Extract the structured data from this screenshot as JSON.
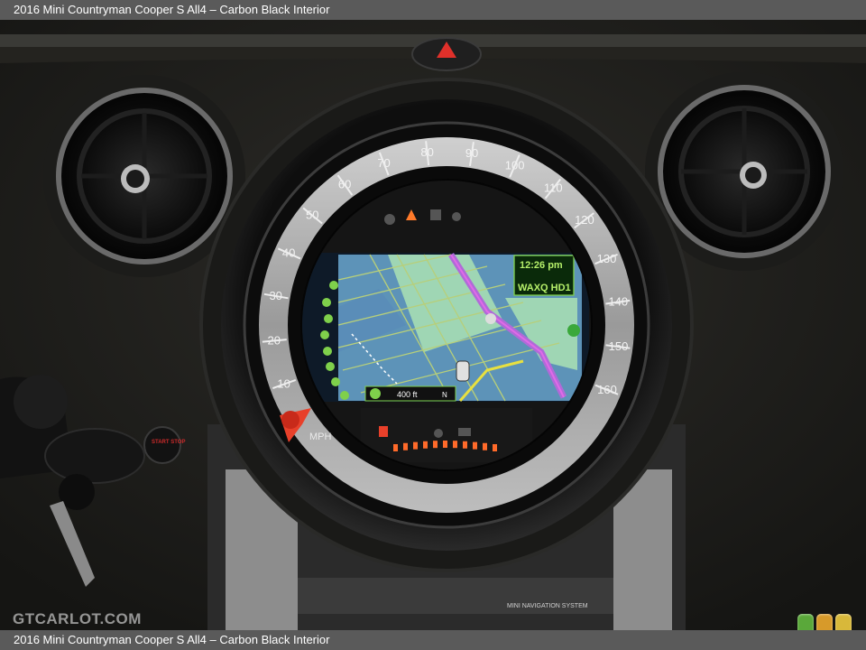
{
  "caption": {
    "top_title": "2016 Mini Countryman Cooper S All4 – Carbon Black Interior",
    "bottom_title": "2016 Mini Countryman Cooper S All4 – Carbon Black Interior"
  },
  "watermark": "GTCARLOT.COM",
  "speedometer": {
    "ticks": [
      "10",
      "20",
      "30",
      "40",
      "50",
      "60",
      "70",
      "80",
      "90",
      "100",
      "110",
      "120",
      "130",
      "140",
      "150",
      "160"
    ],
    "unit": "MPH"
  },
  "navigation": {
    "time": "12:26 pm",
    "station": "WAXQ HD1",
    "distance": "400 ft",
    "heading": "N",
    "system_label": "MINI NAVIGATION SYSTEM"
  },
  "start_stop_label": "START STOP",
  "rating_colors": [
    "#5aa83a",
    "#d79a2a",
    "#d8b83a"
  ],
  "colors": {
    "screen_green": "#7fd04b",
    "map_road": "#b06ad8",
    "warning_red": "#e8402a",
    "gauge_orange": "#ff6a2a"
  }
}
